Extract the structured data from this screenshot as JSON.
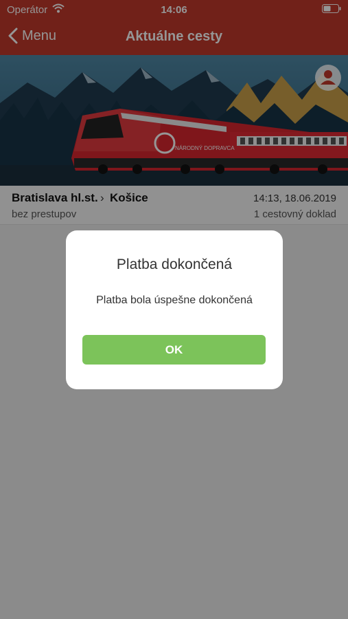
{
  "status_bar": {
    "carrier": "Operátor",
    "time": "14:06",
    "icons": [
      "wifi-icon",
      "battery-icon"
    ]
  },
  "nav": {
    "back_label": "Menu",
    "title": "Aktuálne cesty",
    "back_icon": "chevron-left-icon",
    "avatar_icon": "user-icon"
  },
  "trip": {
    "from": "Bratislava hl.st.",
    "arrow": "›",
    "to": "Košice",
    "datetime": "14:13, 18.06.2019",
    "transfers": "bez prestupov",
    "tickets": "1 cestovný doklad"
  },
  "banner": {
    "logo_text": "NÁRODNÝ DOPRAVCA"
  },
  "dialog": {
    "title": "Platba dokončená",
    "message": "Platba bola úspešne dokončená",
    "ok_label": "OK"
  },
  "colors": {
    "brand_red": "#c0392b",
    "ok_green": "#7cc35a"
  }
}
